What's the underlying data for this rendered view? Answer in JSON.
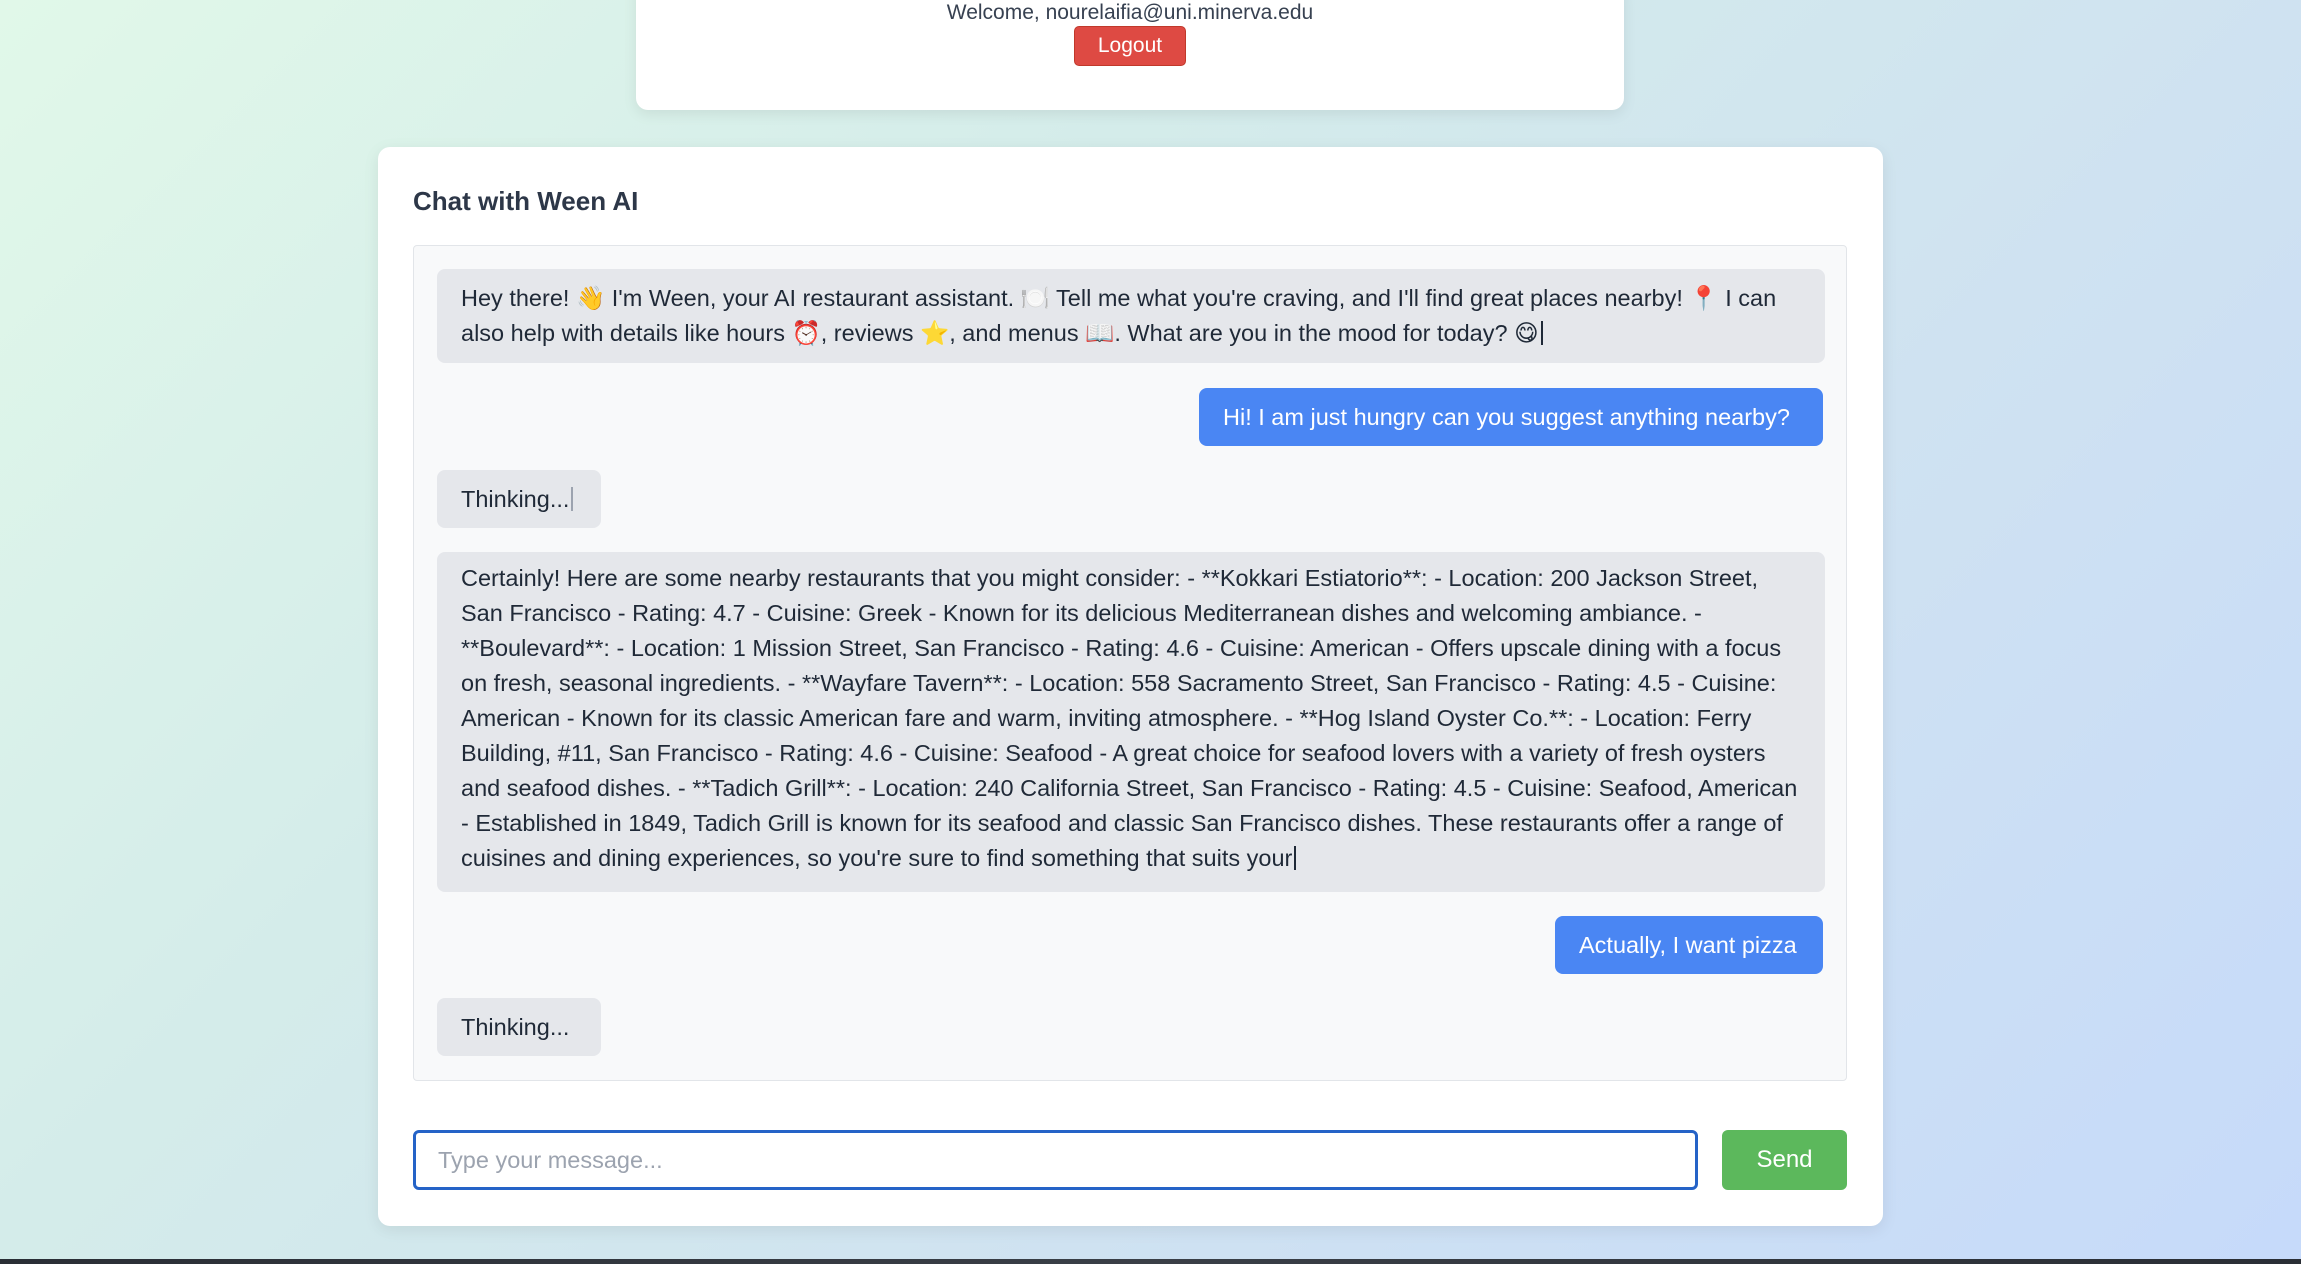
{
  "header": {
    "welcome_text": "Welcome, nourelaifia@uni.minerva.edu",
    "logout_label": "Logout"
  },
  "chat": {
    "title": "Chat with Ween AI",
    "messages": [
      {
        "role": "bot",
        "text": "Hey there! 👋 I'm Ween, your AI restaurant assistant. 🍽️ Tell me what you're craving, and I'll find great places nearby! 📍 I can also help with details like hours ⏰, reviews ⭐, and menus 📖. What are you in the mood for today? 😋"
      },
      {
        "role": "user",
        "text": "Hi! I am just hungry can you suggest anything nearby?"
      },
      {
        "role": "bot",
        "text": "Thinking..."
      },
      {
        "role": "bot",
        "text": "Certainly! Here are some nearby restaurants that you might consider: - **Kokkari Estiatorio**: - Location: 200 Jackson Street, San Francisco - Rating: 4.7 - Cuisine: Greek - Known for its delicious Mediterranean dishes and welcoming ambiance. - **Boulevard**: - Location: 1 Mission Street, San Francisco - Rating: 4.6 - Cuisine: American - Offers upscale dining with a focus on fresh, seasonal ingredients. - **Wayfare Tavern**: - Location: 558 Sacramento Street, San Francisco - Rating: 4.5 - Cuisine: American - Known for its classic American fare and warm, inviting atmosphere. - **Hog Island Oyster Co.**: - Location: Ferry Building, #11, San Francisco - Rating: 4.6 - Cuisine: Seafood - A great choice for seafood lovers with a variety of fresh oysters and seafood dishes. - **Tadich Grill**: - Location: 240 California Street, San Francisco - Rating: 4.5 - Cuisine: Seafood, American - Established in 1849, Tadich Grill is known for its seafood and classic San Francisco dishes. These restaurants offer a range of cuisines and dining experiences, so you're sure to find something that suits your"
      },
      {
        "role": "user",
        "text": "Actually, I want pizza"
      },
      {
        "role": "bot",
        "text": "Thinking..."
      }
    ]
  },
  "composer": {
    "input_value": "",
    "placeholder": "Type your message...",
    "send_label": "Send"
  },
  "colors": {
    "user_bubble": "#4a86f3",
    "bot_bubble": "#e5e7eb",
    "logout": "#de4a43",
    "send": "#5cb85c",
    "input_focus": "#2563c7"
  }
}
